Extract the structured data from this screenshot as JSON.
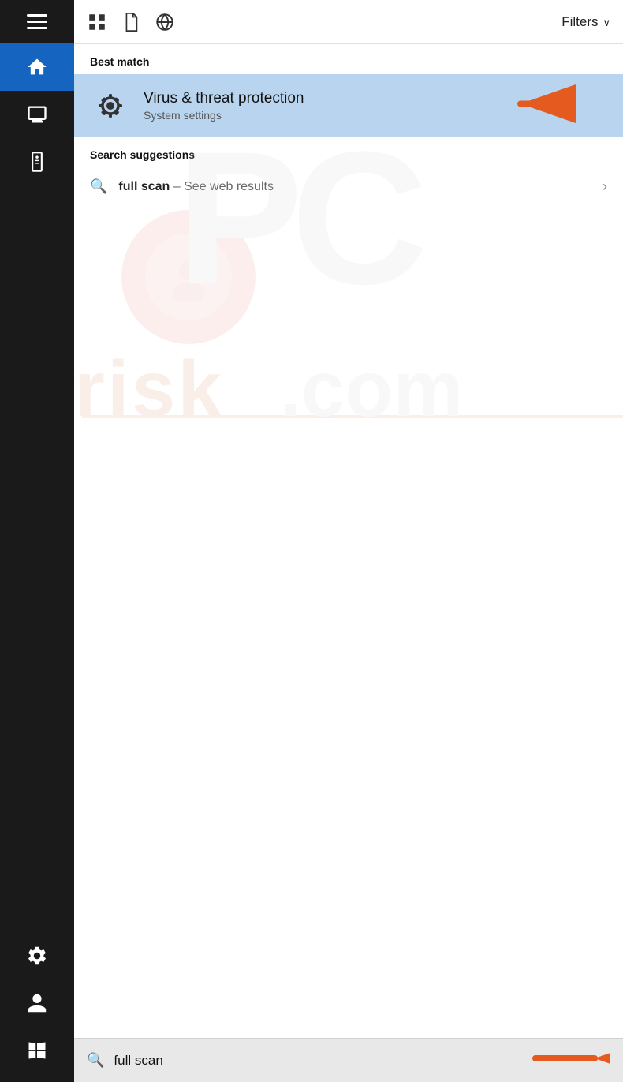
{
  "toolbar": {
    "filters_label": "Filters",
    "chevron": "∨",
    "icons": [
      "grid-icon",
      "document-icon",
      "globe-icon"
    ]
  },
  "sidebar": {
    "items": [
      {
        "name": "home",
        "active": true
      },
      {
        "name": "display",
        "active": false
      },
      {
        "name": "tower",
        "active": false
      }
    ],
    "bottom": [
      {
        "name": "settings"
      },
      {
        "name": "user"
      },
      {
        "name": "windows-start"
      }
    ]
  },
  "results": {
    "best_match_label": "Best match",
    "best_match_title": "Virus & threat protection",
    "best_match_subtitle": "System settings",
    "search_suggestions_label": "Search suggestions",
    "suggestion": {
      "bold": "full scan",
      "muted": " – See web results"
    }
  },
  "search_bar": {
    "value": "full scan",
    "placeholder": "full scan"
  }
}
